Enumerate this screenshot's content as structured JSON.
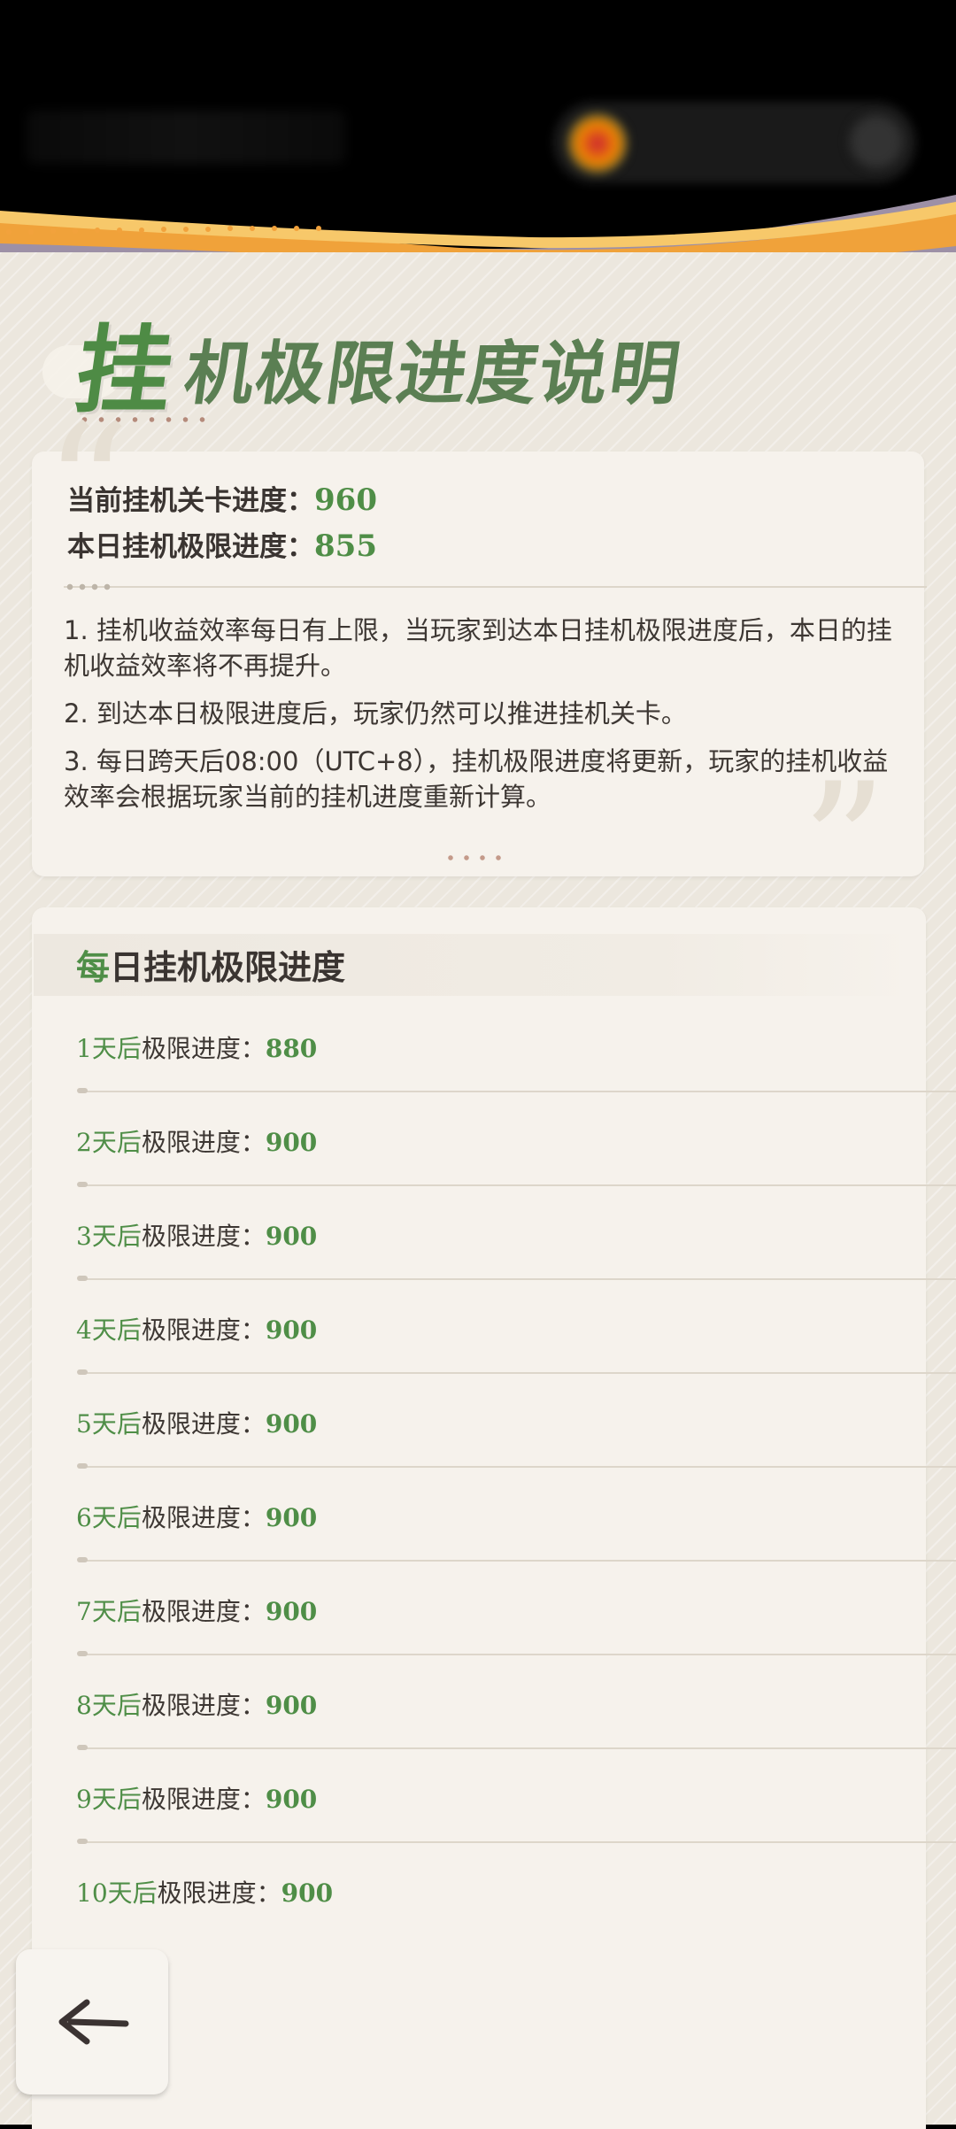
{
  "title": {
    "first_char": "挂",
    "rest": "机极限进度说明"
  },
  "summary": {
    "current_label": "当前挂机关卡进度：",
    "current_value": "960",
    "today_label": "本日挂机极限进度：",
    "today_value": "855"
  },
  "notes": [
    "1. 挂机收益效率每日有上限，当玩家到达本日挂机极限进度后，本日的挂机收益效率将不再提升。",
    "2. 到达本日极限进度后，玩家仍然可以推进挂机关卡。",
    "3. 每日跨天后08:00（UTC+8），挂机极限进度将更新，玩家的挂机收益效率会根据玩家当前的挂机进度重新计算。"
  ],
  "daily": {
    "title_highlight": "每",
    "title_rest": "日挂机极限进度",
    "rows": [
      {
        "day": "1天后",
        "label": "极限进度：",
        "value": "880"
      },
      {
        "day": "2天后",
        "label": "极限进度：",
        "value": "900"
      },
      {
        "day": "3天后",
        "label": "极限进度：",
        "value": "900"
      },
      {
        "day": "4天后",
        "label": "极限进度：",
        "value": "900"
      },
      {
        "day": "5天后",
        "label": "极限进度：",
        "value": "900"
      },
      {
        "day": "6天后",
        "label": "极限进度：",
        "value": "900"
      },
      {
        "day": "7天后",
        "label": "极限进度：",
        "value": "900"
      },
      {
        "day": "8天后",
        "label": "极限进度：",
        "value": "900"
      },
      {
        "day": "9天后",
        "label": "极限进度：",
        "value": "900"
      },
      {
        "day": "10天后",
        "label": "极限进度：",
        "value": "900"
      }
    ]
  },
  "icons": {
    "back": "back-arrow-icon"
  },
  "colors": {
    "accent_green": "#4f8e47",
    "band_orange": "#f0a23a",
    "band_purple": "#9d90a6"
  }
}
